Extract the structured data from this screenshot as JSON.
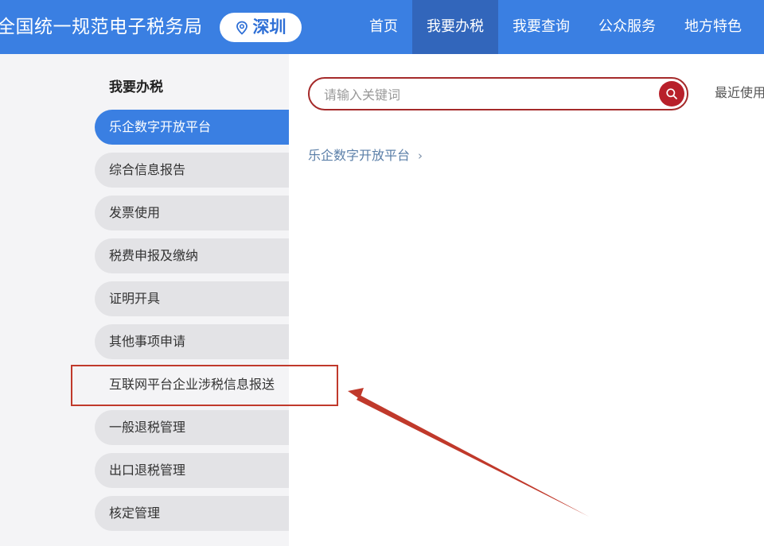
{
  "header": {
    "site_title": "全国统一规范电子税务局",
    "city": "深圳",
    "nav": [
      {
        "label": "首页",
        "active": false
      },
      {
        "label": "我要办税",
        "active": true
      },
      {
        "label": "我要查询",
        "active": false
      },
      {
        "label": "公众服务",
        "active": false
      },
      {
        "label": "地方特色",
        "active": false
      }
    ]
  },
  "sidebar": {
    "title": "我要办税",
    "items": [
      {
        "label": "乐企数字开放平台"
      },
      {
        "label": "综合信息报告"
      },
      {
        "label": "发票使用"
      },
      {
        "label": "税费申报及缴纳"
      },
      {
        "label": "证明开具"
      },
      {
        "label": "其他事项申请"
      },
      {
        "label": "互联网平台企业涉税信息报送"
      },
      {
        "label": "一般退税管理"
      },
      {
        "label": "出口退税管理"
      },
      {
        "label": "核定管理"
      }
    ]
  },
  "content": {
    "search_placeholder": "请输入关键词",
    "recent_label": "最近使用",
    "breadcrumb": "乐企数字开放平台"
  },
  "colors": {
    "header_bg": "#3a7fe2",
    "nav_active_bg": "#3266bb",
    "search_border": "#a52a2a",
    "search_button": "#b8202a",
    "annotation_red": "#c0392b"
  },
  "icons": {
    "city": "location-pin-icon",
    "search": "search-icon",
    "breadcrumb": "chevron-right-icon"
  }
}
